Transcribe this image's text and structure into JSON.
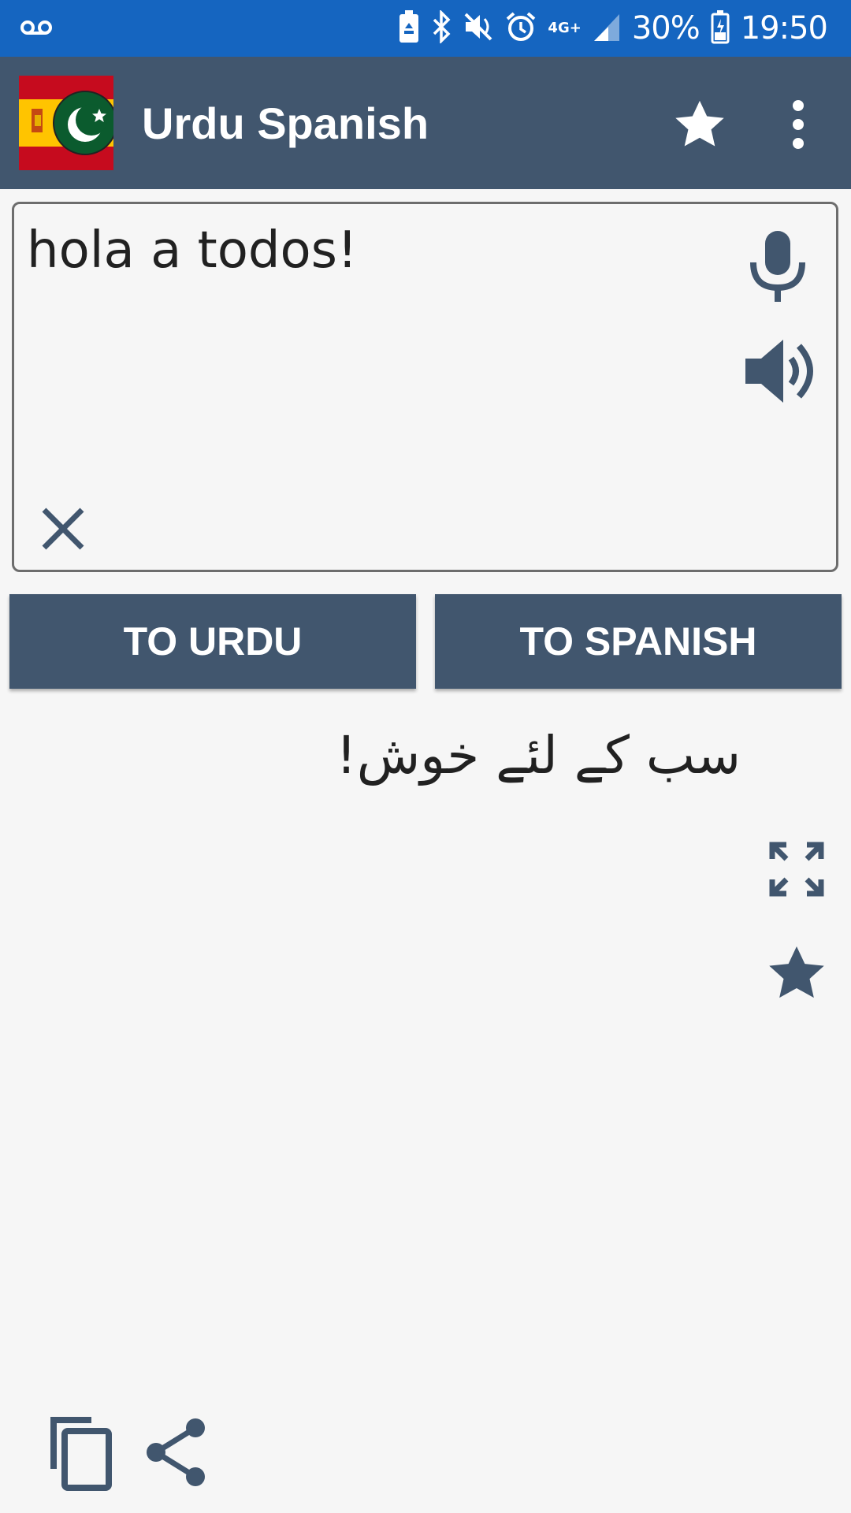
{
  "status_bar": {
    "network_label": "4G+",
    "battery": "30%",
    "time": "19:50"
  },
  "app_bar": {
    "title": "Urdu Spanish"
  },
  "input": {
    "text": "hola a todos!"
  },
  "buttons": {
    "to_urdu": "TO URDU",
    "to_spanish": "TO SPANISH"
  },
  "output": {
    "text": "سب کے لئے خوش!"
  },
  "colors": {
    "status_bar": "#1565c0",
    "app_bar": "#41566e",
    "accent": "#41566e",
    "background": "#f6f6f6"
  },
  "icons": [
    "voicemail-icon",
    "battery-saver-icon",
    "bluetooth-icon",
    "mute-icon",
    "alarm-icon",
    "signal-icon",
    "battery-icon",
    "flag-icon",
    "star-icon",
    "more-vert-icon",
    "mic-icon",
    "speaker-icon",
    "clear-icon",
    "expand-icon",
    "favorite-star-icon",
    "copy-icon",
    "share-icon"
  ]
}
